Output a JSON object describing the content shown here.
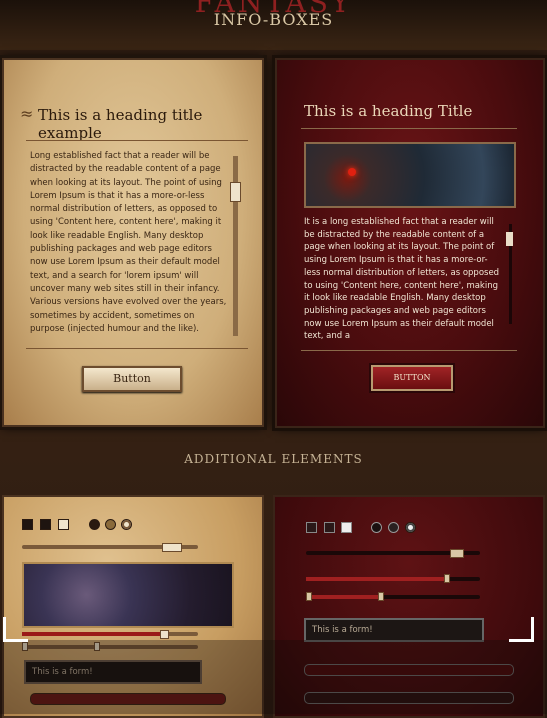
{
  "header": {
    "brand": "FANTASY",
    "subtitle": "INFO-BOXES"
  },
  "parchment_box": {
    "title": "This is a heading title example",
    "body": "Long established fact that a reader will be distracted by the readable content of a page when looking at its layout. The point of using Lorem Ipsum is that it has a more-or-less normal distribution of letters, as opposed to using 'Content here, content here', making it look like readable English. Many desktop publishing packages and web page editors now use Lorem Ipsum as their default model text, and a search for 'lorem ipsum' will uncover many web sites still in their infancy. Various versions have evolved over the years, sometimes by accident, sometimes on purpose (injected humour and the like).",
    "button_label": "Button"
  },
  "red_box": {
    "title": "This is a heading Title",
    "body": "It is a long established fact that a reader will be distracted by the readable content of a page when looking at its layout. The point of using Lorem Ipsum is that it has a more-or-less normal distribution of letters, as opposed to using 'Content here, content here', making it look like readable English. Many desktop publishing packages and web page editors now use Lorem Ipsum as their default model text, and a",
    "button_label": "BUTTON"
  },
  "additional": {
    "title": "ADDITIONAL ELEMENTS",
    "left_field": "This is a form!",
    "right_field": "This is a form!",
    "checkboxes_checked": [
      false,
      false,
      true
    ],
    "radios_selected": 2
  },
  "colors": {
    "accent_red": "#8e2020",
    "parchment": "#d8b985",
    "dark_red": "#4a0c0e"
  }
}
